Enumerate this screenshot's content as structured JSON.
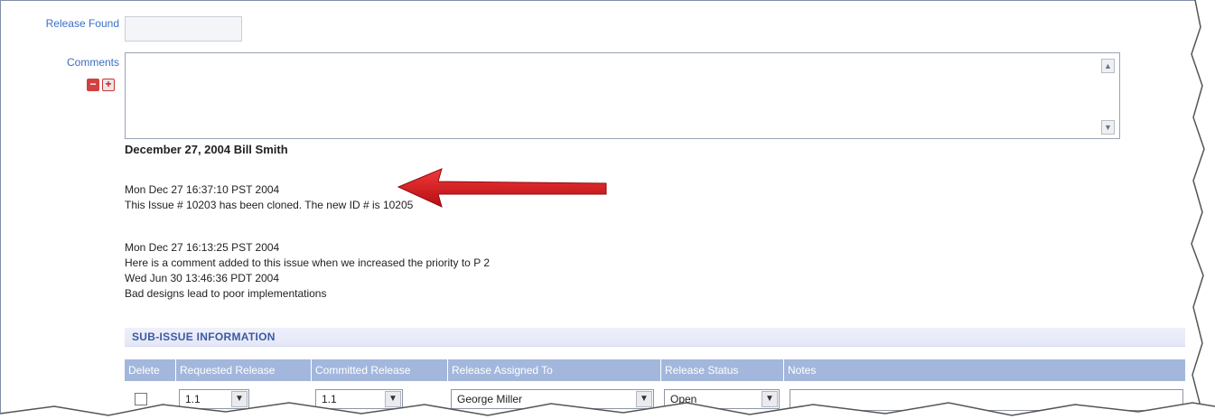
{
  "form": {
    "release_found_label": "Release Found",
    "release_found_value": "",
    "comments_label": "Comments",
    "comments_value": ""
  },
  "comments_log": {
    "heading": "December 27, 2004 Bill Smith",
    "entries": [
      {
        "timestamp": "Mon Dec 27 16:37:10 PST 2004",
        "text": "This Issue # 10203 has been cloned. The new ID # is 10205"
      },
      {
        "timestamp": "Mon Dec 27 16:13:25 PST 2004",
        "text": "Here is a comment added to this issue when we increased the priority to P 2"
      },
      {
        "timestamp": "Wed Jun 30 13:46:36 PDT 2004",
        "text": "Bad designs lead to poor implementations"
      }
    ]
  },
  "sub_issue": {
    "section_title": "SUB-ISSUE INFORMATION",
    "columns": [
      "Delete",
      "Requested Release",
      "Committed Release",
      "Release Assigned To",
      "Release Status",
      "Notes"
    ],
    "row": {
      "delete_checked": false,
      "requested_release": "1.1",
      "committed_release": "1.1",
      "assigned_to": "George Miller",
      "status": "Open",
      "notes": ""
    }
  },
  "icons": {
    "collapse": "minus-icon",
    "expand": "plus-icon",
    "annotation": "red-arrow-icon"
  },
  "colors": {
    "label_blue": "#3a6ec7",
    "header_blue": "#a3b7dc",
    "section_title": "#3c5aa3",
    "arrow_red": "#d0151b"
  }
}
